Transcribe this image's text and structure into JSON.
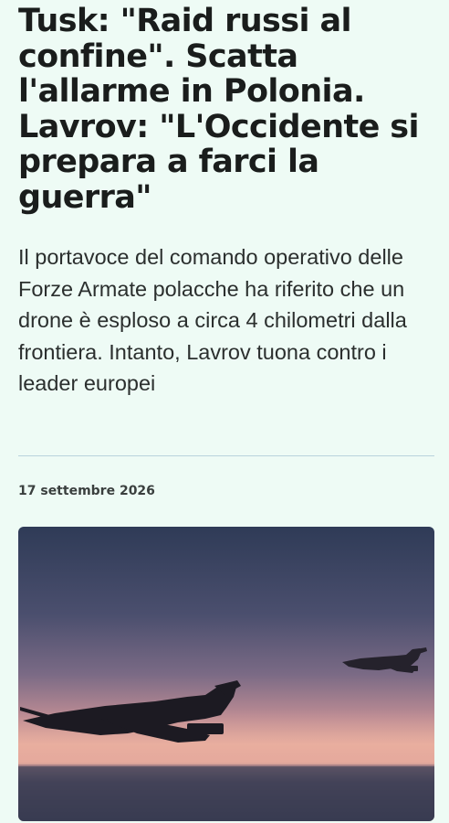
{
  "article": {
    "headline": "Tusk: \"Raid russi al confine\". Scatta l'allarme in Polonia. Lavrov: \"L'Occidente si prepara a farci la guerra\"",
    "summary": "Il portavoce del comando operativo delle Forze Armate polacche ha riferito che un drone è esploso a circa 4 chilometri dalla frontiera. Intanto, Lavrov tuona contro i leader europei",
    "date": "17 settembre 2026"
  },
  "colors": {
    "page_background": "#eefbf5",
    "divider": "#b9d3dc",
    "headline_text": "#1a1d1c"
  }
}
